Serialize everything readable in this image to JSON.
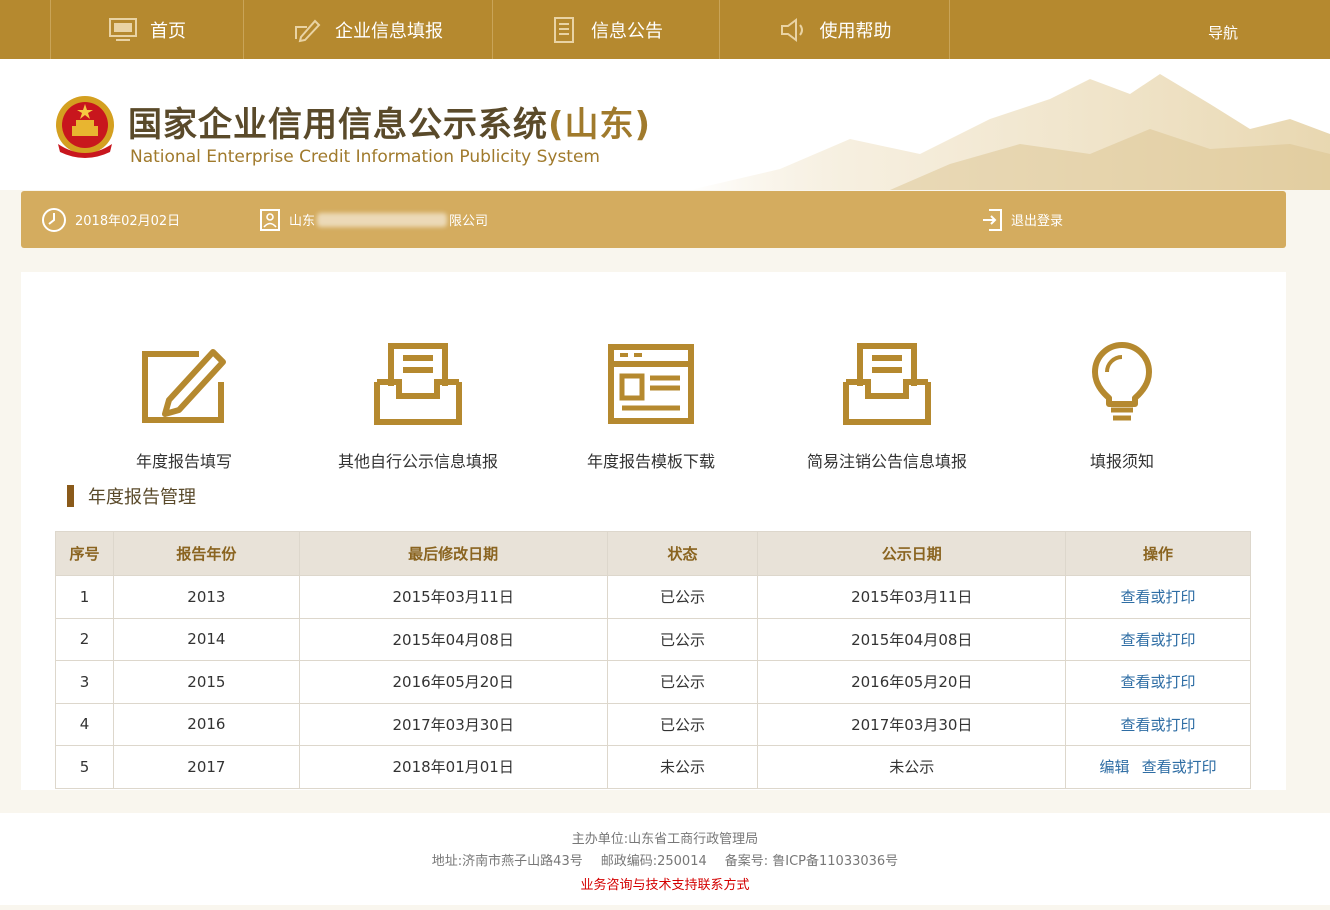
{
  "nav": {
    "items": [
      {
        "label": "首页",
        "icon": "monitor-icon"
      },
      {
        "label": "企业信息填报",
        "icon": "edit-icon"
      },
      {
        "label": "信息公告",
        "icon": "document-icon"
      },
      {
        "label": "使用帮助",
        "icon": "speaker-icon"
      }
    ],
    "guide": "导航"
  },
  "banner": {
    "title_cn": "国家企业信用信息公示系统",
    "title_province": "(山东)",
    "title_en": "National Enterprise Credit Information Publicity System"
  },
  "infobar": {
    "date": "2018年02月02日",
    "company_prefix": "山东",
    "company_suffix": "限公司",
    "logout": "退出登录"
  },
  "tiles": [
    {
      "label": "年度报告填写",
      "icon": "edit-report-icon"
    },
    {
      "label": "其他自行公示信息填报",
      "icon": "inbox-icon"
    },
    {
      "label": "年度报告模板下载",
      "icon": "template-icon"
    },
    {
      "label": "简易注销公告信息填报",
      "icon": "inbox-icon"
    },
    {
      "label": "填报须知",
      "icon": "lightbulb-icon"
    }
  ],
  "section": {
    "title": "年度报告管理"
  },
  "table": {
    "headers": [
      "序号",
      "报告年份",
      "最后修改日期",
      "状态",
      "公示日期",
      "操作"
    ],
    "rows": [
      {
        "no": "1",
        "year": "2013",
        "modified": "2015年03月11日",
        "status": "已公示",
        "pub_date": "2015年03月11日",
        "edit": "",
        "view": "查看或打印"
      },
      {
        "no": "2",
        "year": "2014",
        "modified": "2015年04月08日",
        "status": "已公示",
        "pub_date": "2015年04月08日",
        "edit": "",
        "view": "查看或打印"
      },
      {
        "no": "3",
        "year": "2015",
        "modified": "2016年05月20日",
        "status": "已公示",
        "pub_date": "2016年05月20日",
        "edit": "",
        "view": "查看或打印"
      },
      {
        "no": "4",
        "year": "2016",
        "modified": "2017年03月30日",
        "status": "已公示",
        "pub_date": "2017年03月30日",
        "edit": "",
        "view": "查看或打印"
      },
      {
        "no": "5",
        "year": "2017",
        "modified": "2018年01月01日",
        "status": "未公示",
        "pub_date": "未公示",
        "edit": "编辑",
        "view": "查看或打印"
      }
    ]
  },
  "footer": {
    "sponsor": "主办单位:山东省工商行政管理局",
    "address": "地址:济南市燕子山路43号",
    "postcode": "邮政编码:250014",
    "icp": "备案号: 鲁ICP备11033036号",
    "support": "业务咨询与技术支持联系方式"
  },
  "colors": {
    "nav_bg": "#b5892f",
    "infobar_bg": "#d4ac5f",
    "accent": "#a07a2c",
    "link": "#2e6da4",
    "alert": "#d40000"
  }
}
